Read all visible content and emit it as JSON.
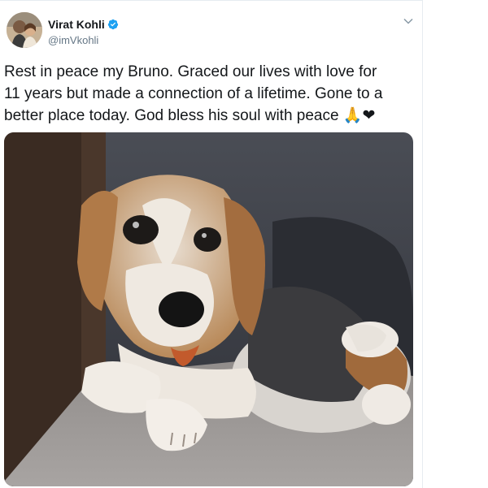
{
  "tweet": {
    "display_name": "Virat Kohli",
    "handle": "@imVkohli",
    "text": "Rest in peace my Bruno. Graced our lives with love for\n11 years but made a connection of a lifetime. Gone to a\nbetter place today. God bless his soul with peace",
    "emojis": "🙏❤",
    "verified": true
  },
  "icons": {
    "verified": "verified-badge-icon",
    "more": "chevron-down-icon"
  },
  "colors": {
    "verified_blue": "#1da1f2",
    "handle_gray": "#657786",
    "heart_red": "#e0245e",
    "text": "#14171a"
  }
}
